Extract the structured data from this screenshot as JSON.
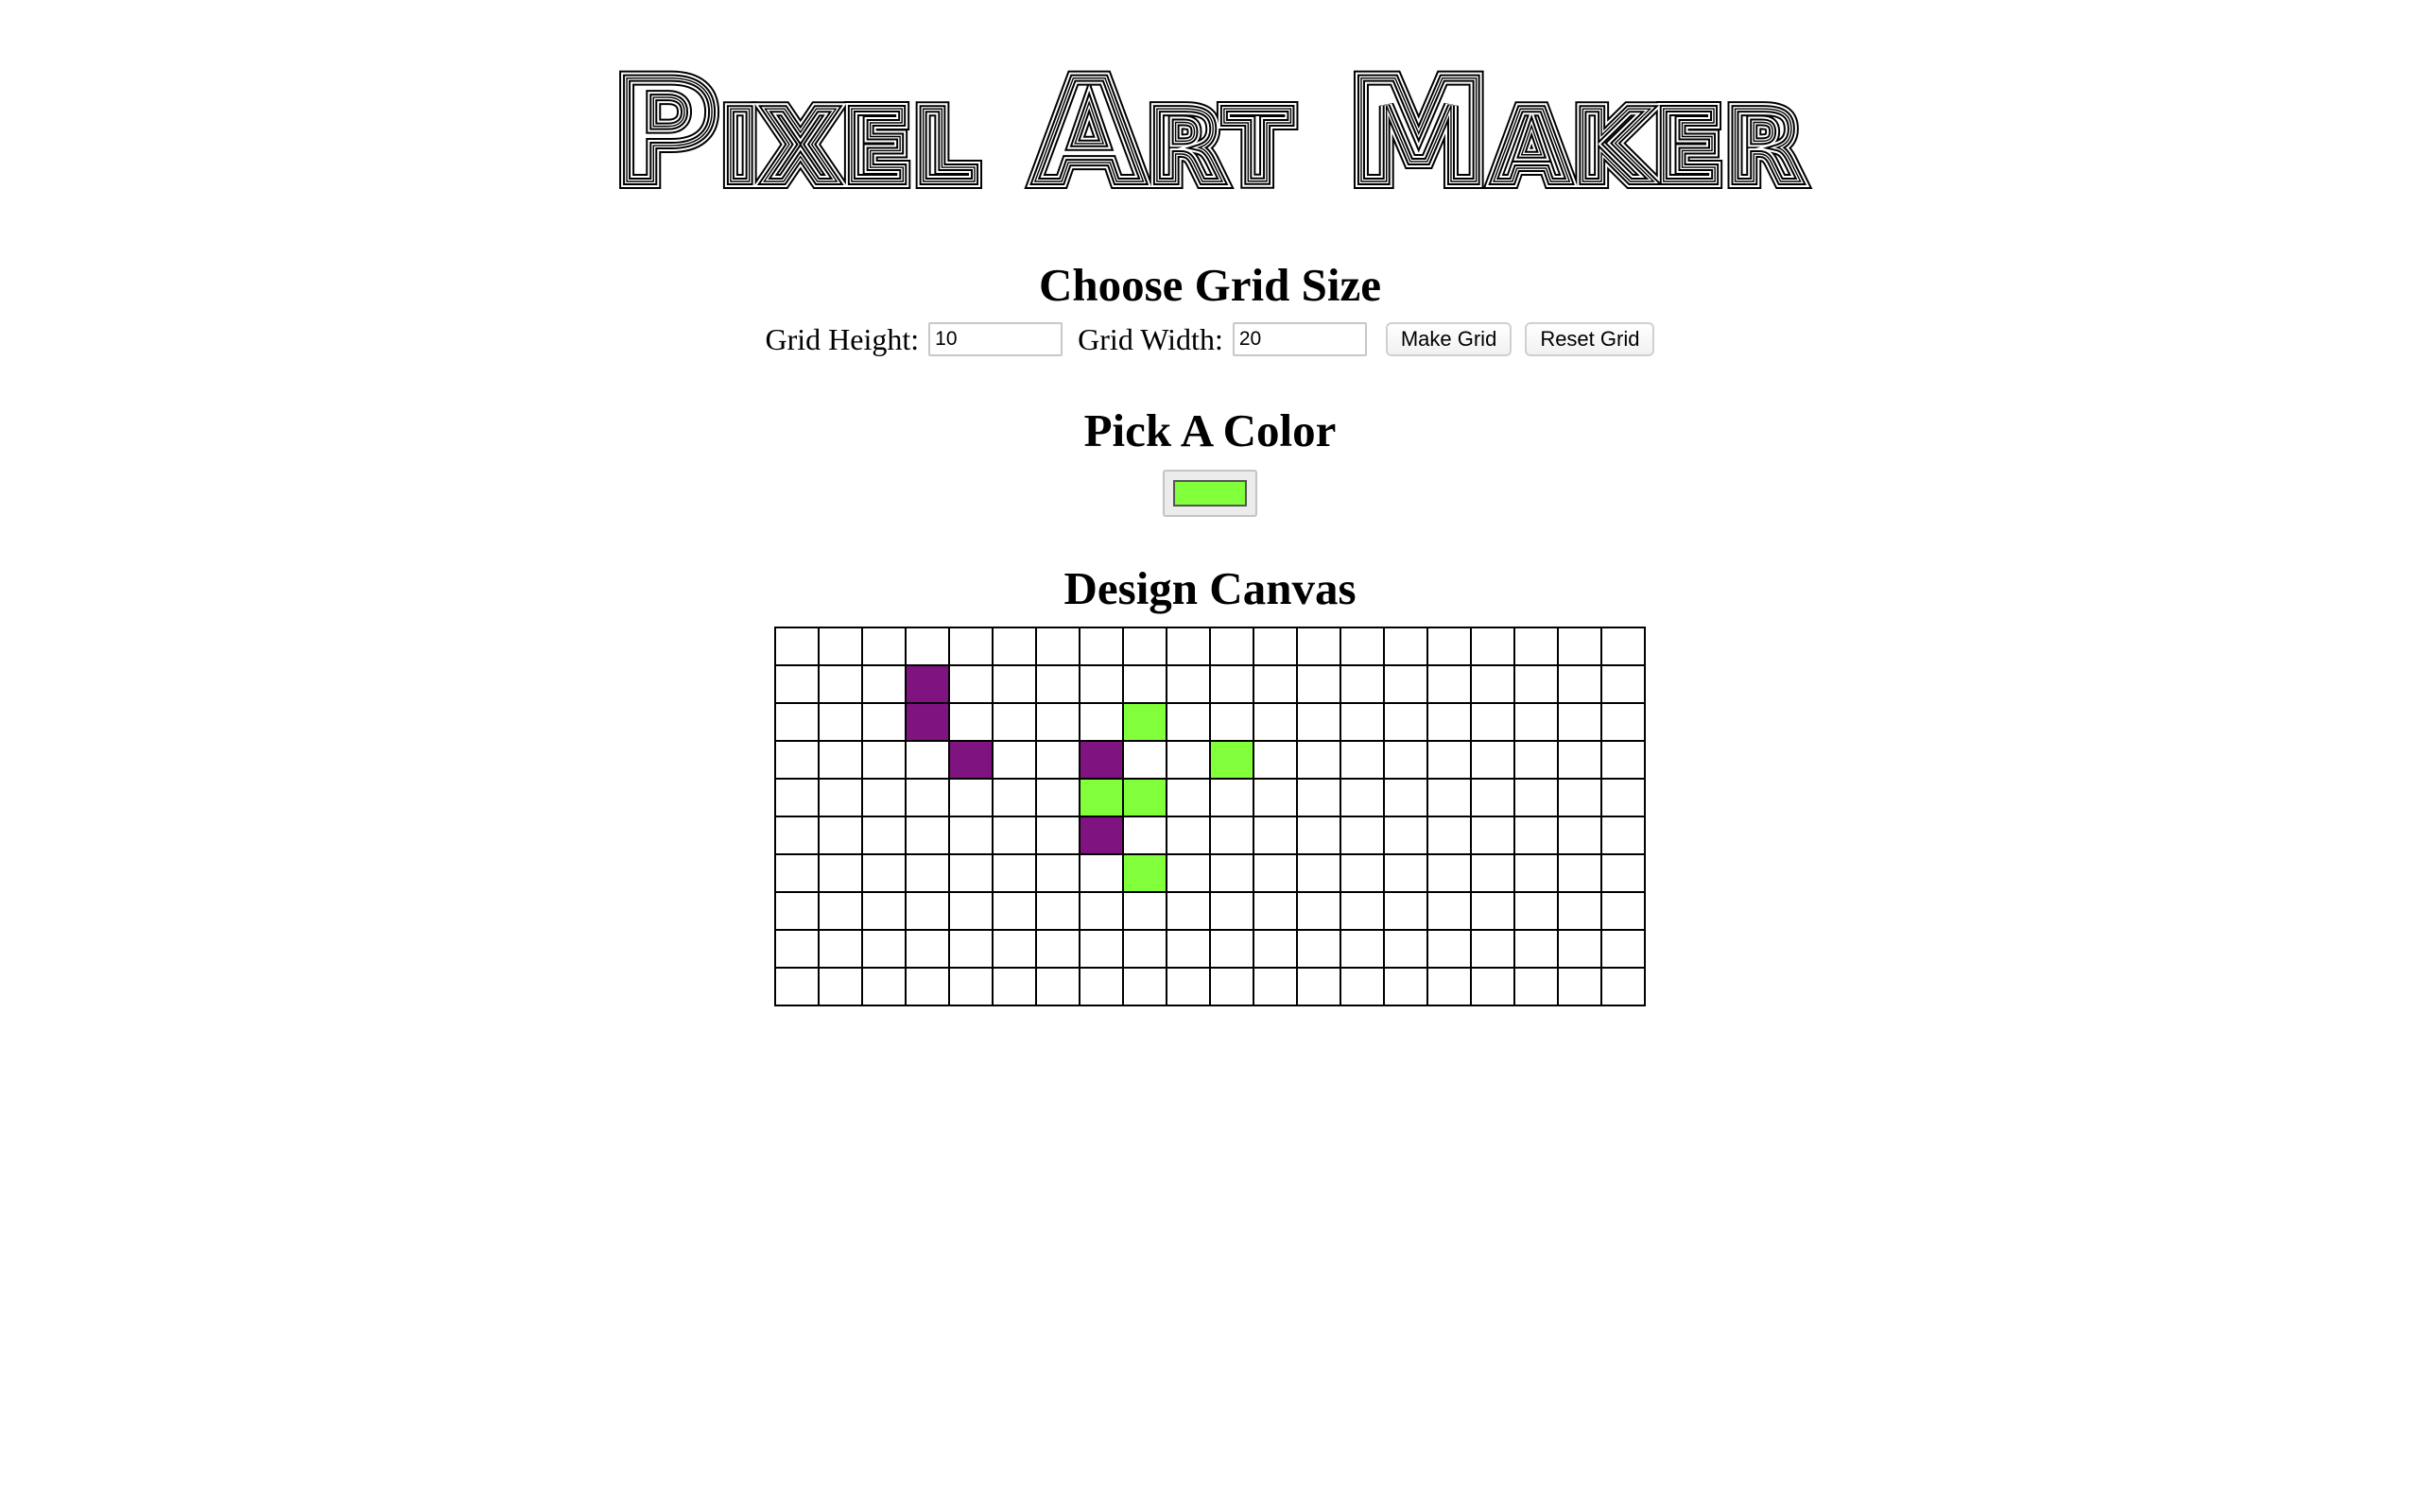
{
  "title": "Pixel Art Maker",
  "grid_size": {
    "heading": "Choose Grid Size",
    "height_label": "Grid Height:",
    "height_value": "10",
    "width_label": "Grid Width:",
    "width_value": "20",
    "make_button": "Make Grid",
    "reset_button": "Reset Grid"
  },
  "color": {
    "heading": "Pick A Color",
    "selected": "#80ff3a"
  },
  "canvas": {
    "heading": "Design Canvas",
    "rows": 10,
    "cols": 20,
    "colors": {
      "P": "#7f137f",
      "G": "#80ff3a"
    },
    "cells": [
      "....................",
      "...P................",
      "...P....G...........",
      "....P..P..G.........",
      ".......GG...........",
      ".......P............",
      "........G...........",
      "....................",
      "....................",
      "...................."
    ]
  }
}
